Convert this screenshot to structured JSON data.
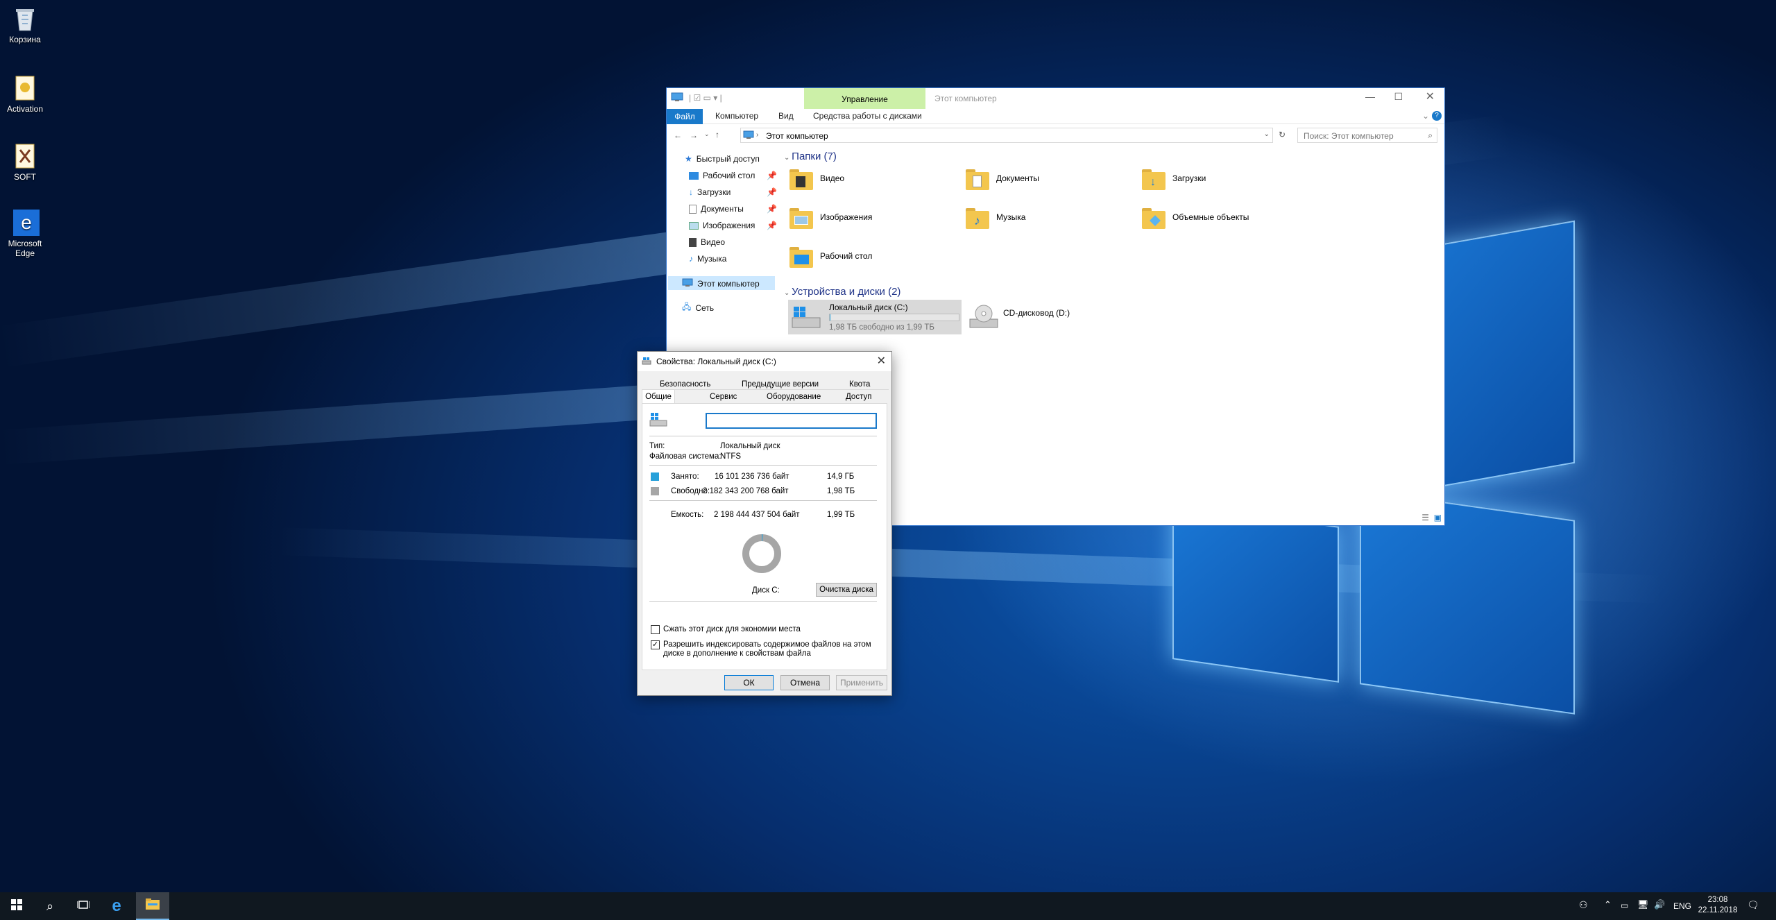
{
  "desktop": {
    "icons": [
      {
        "label": "Корзина"
      },
      {
        "label": "Activation"
      },
      {
        "label": "SOFT"
      },
      {
        "label": "Microsoft Edge"
      }
    ]
  },
  "explorer": {
    "title": "Этот компьютер",
    "ribbon_context": "Управление",
    "tabs": [
      "Файл",
      "Компьютер",
      "Вид",
      "Средства работы с дисками"
    ],
    "address": "Этот компьютер",
    "search_placeholder": "Поиск: Этот компьютер",
    "nav": {
      "quick_access": "Быстрый доступ",
      "items": [
        "Рабочий стол",
        "Загрузки",
        "Документы",
        "Изображения",
        "Видео",
        "Музыка"
      ],
      "this_pc": "Этот компьютер",
      "network": "Сеть"
    },
    "folders_header": "Папки (7)",
    "folders": [
      "Видео",
      "Документы",
      "Загрузки",
      "Изображения",
      "Музыка",
      "Объемные объекты",
      "Рабочий стол"
    ],
    "drives_header": "Устройства и диски (2)",
    "drives": [
      {
        "name": "Локальный диск (C:)",
        "detail": "1,98 ТБ свободно из 1,99 ТБ",
        "used_fraction": 0.0075
      },
      {
        "name": "CD-дисковод (D:)",
        "detail": ""
      }
    ]
  },
  "dialog": {
    "title": "Свойства: Локальный диск (C:)",
    "tabs_row1": [
      "Безопасность",
      "Предыдущие версии",
      "Квота"
    ],
    "tabs_row2": [
      "Общие",
      "Сервис",
      "Оборудование",
      "Доступ"
    ],
    "active_tab": "Общие",
    "name_value": "",
    "type_label": "Тип:",
    "type_value": "Локальный диск",
    "fs_label": "Файловая система:",
    "fs_value": "NTFS",
    "used_label": "Занято:",
    "used_bytes": "16 101 236 736 байт",
    "used_human": "14,9 ГБ",
    "free_label": "Свободно:",
    "free_bytes": "2 182 343 200 768 байт",
    "free_human": "1,98 ТБ",
    "capacity_label": "Емкость:",
    "capacity_bytes": "2 198 444 437 504 байт",
    "capacity_human": "1,99 ТБ",
    "disk_label": "Диск C:",
    "cleanup_button": "Очистка диска",
    "compress_label": "Сжать этот диск для экономии места",
    "compress_checked": false,
    "index_label": "Разрешить индексировать содержимое файлов на этом диске в дополнение к свойствам файла",
    "index_checked": true,
    "ok": "ОК",
    "cancel": "Отмена",
    "apply": "Применить",
    "colors": {
      "used": "#26a0da",
      "free": "#a6a6a6"
    }
  },
  "taskbar": {
    "lang": "ENG",
    "time": "23:08",
    "date": "22.11.2018"
  }
}
